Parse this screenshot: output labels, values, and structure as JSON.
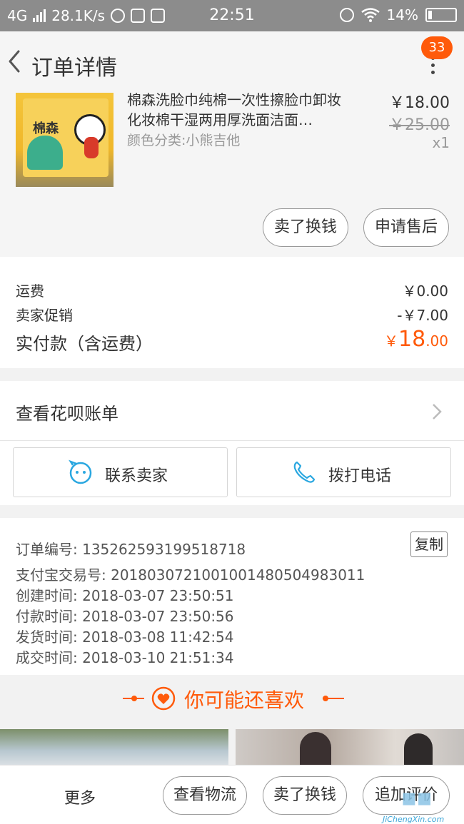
{
  "status_bar": {
    "network": "4G",
    "speed": "28.1K/s",
    "time": "22:51",
    "battery": "14%"
  },
  "header": {
    "title": "订单详情",
    "badge_count": "33"
  },
  "product": {
    "name": "棉森洗脸巾纯棉一次性擦脸巾卸妆化妆棉干湿两用厚洗面洁面…",
    "attribute": "颜色分类:小熊吉他",
    "price": "￥18.00",
    "original_price": "￥25.00",
    "quantity": "x1",
    "thumb_label": "棉森",
    "actions": [
      "卖了换钱",
      "申请售后"
    ]
  },
  "fees": {
    "shipping_label": "运费",
    "shipping_value": "￥0.00",
    "promo_label": "卖家促销",
    "promo_value": "-￥7.00",
    "total_label": "实付款（含运费）",
    "total_currency": "￥",
    "total_int": "18",
    "total_dec": ".00"
  },
  "huabei": {
    "label": "查看花呗账单"
  },
  "contact": {
    "seller": "联系卖家",
    "phone": "拨打电话"
  },
  "order_info": {
    "order_no": "订单编号: 135262593199518718",
    "copy": "复制",
    "alipay_no": "支付宝交易号: 2018030721001001480504983011",
    "created": "创建时间: 2018-03-07 23:50:51",
    "paid": "付款时间: 2018-03-07 23:50:56",
    "shipped": "发货时间: 2018-03-08 11:42:54",
    "completed": "成交时间: 2018-03-10 21:51:34"
  },
  "recommend": {
    "title": "你可能还喜欢"
  },
  "bottom_bar": {
    "more": "更多",
    "buttons": [
      "查看物流",
      "卖了换钱",
      "追加评价"
    ]
  },
  "watermark": {
    "text": "JiChengXin.com"
  },
  "colors": {
    "accent": "#ff5a0a",
    "link_blue": "#2aa7e0"
  }
}
